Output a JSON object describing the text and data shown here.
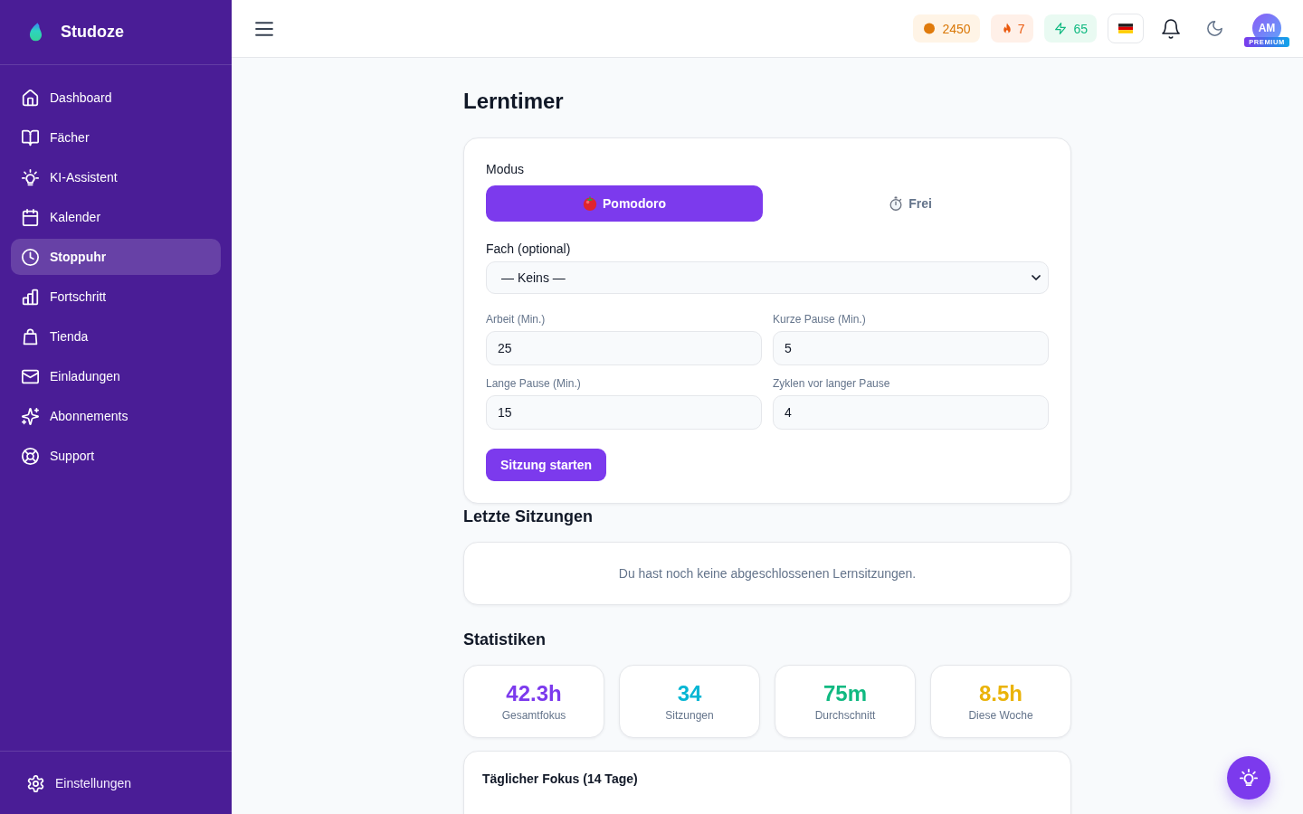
{
  "sidebar": {
    "brand": "Studoze",
    "items": [
      {
        "label": "Dashboard",
        "selected": false
      },
      {
        "label": "Fächer",
        "selected": false
      },
      {
        "label": "KI-Assistent",
        "selected": false
      },
      {
        "label": "Kalender",
        "selected": false
      },
      {
        "label": "Stoppuhr",
        "selected": true
      },
      {
        "label": "Fortschritt",
        "selected": false
      },
      {
        "label": "Tienda",
        "selected": false
      },
      {
        "label": "Einladungen",
        "selected": false
      },
      {
        "label": "Abonnements",
        "selected": false
      },
      {
        "label": "Support",
        "selected": false
      }
    ],
    "footer_item": "Einstellungen"
  },
  "topbar": {
    "counters": [
      {
        "kind": "coins",
        "value": "2450"
      },
      {
        "kind": "streak",
        "value": "7"
      },
      {
        "kind": "energy",
        "value": "65"
      }
    ],
    "avatar": {
      "initials": "AM",
      "badge": "PREMIUM"
    }
  },
  "page_title": "Lerntimer",
  "timer_form": {
    "mode_label": "Modus",
    "modes": [
      {
        "kind": "pomodoro",
        "label": "Pomodoro",
        "selected": true
      },
      {
        "kind": "free",
        "label": "Frei",
        "selected": false
      }
    ],
    "subject": {
      "label": "Fach (optional)",
      "value": "— Keins —"
    },
    "fields": [
      {
        "label": "Arbeit (Min.)",
        "value": "25"
      },
      {
        "label": "Kurze Pause (Min.)",
        "value": "5"
      },
      {
        "label": "Lange Pause (Min.)",
        "value": "15"
      },
      {
        "label": "Zyklen vor langer Pause",
        "value": "4"
      }
    ],
    "start_button": "Sitzung starten"
  },
  "recent_sessions": {
    "title": "Letzte Sitzungen",
    "empty_message": "Du hast noch keine abgeschlossenen Lernsitzungen."
  },
  "statistics": {
    "title": "Statistiken",
    "cards": [
      {
        "value": "42.3h",
        "label": "Gesamtfokus",
        "color": "#7c3aed"
      },
      {
        "value": "34",
        "label": "Sitzungen",
        "color": "#06b6d4"
      },
      {
        "value": "75m",
        "label": "Durchschnitt",
        "color": "#10b981"
      },
      {
        "value": "8.5h",
        "label": "Diese Woche",
        "color": "#eab308"
      }
    ]
  },
  "daily_focus": {
    "title": "Täglicher Fokus (14 Tage)"
  }
}
